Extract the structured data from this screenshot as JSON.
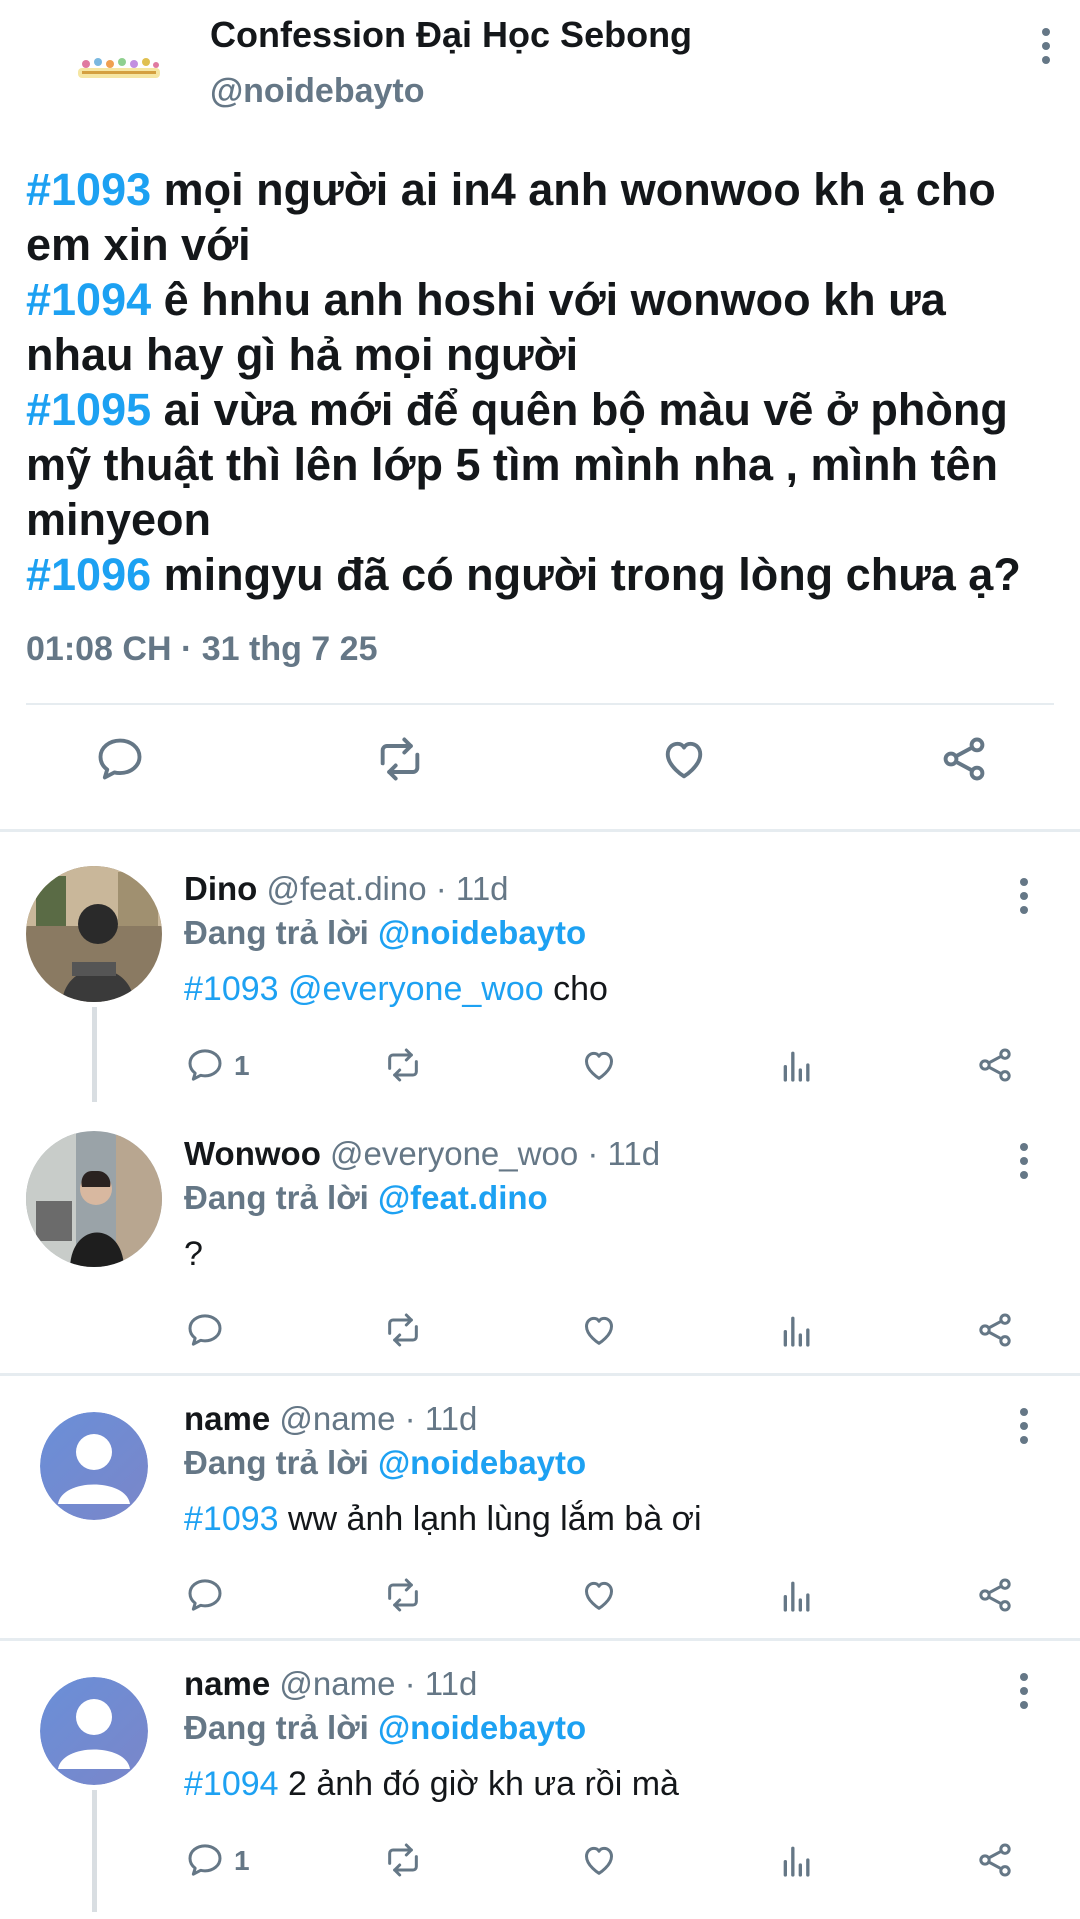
{
  "account": {
    "name": "Confession Đại Học Sebong",
    "handle": "@noidebayto"
  },
  "tweet": {
    "confessions": [
      {
        "tag": "#1093",
        "text": " mọi người ai in4 anh wonwoo kh ạ cho em xin với"
      },
      {
        "tag": "#1094",
        "text": " ê hnhu anh hoshi với wonwoo kh ưa nhau hay gì hả mọi người"
      },
      {
        "tag": "#1095",
        "text": " ai vừa mới để quên bộ màu vẽ ở phòng mỹ thuật thì lên lớp 5 tìm mình nha , mình tên minyeon"
      },
      {
        "tag": "#1096",
        "text": " mingyu đã có người trong lòng chưa ạ?"
      }
    ],
    "timestamp": "01:08 CH · 31 thg 7 25"
  },
  "replies": [
    {
      "name": "Dino",
      "meta": " @feat.dino · 11d",
      "replying_prefix": "Đang trả lời ",
      "replying_to": "@noidebayto",
      "text_highlight": "#1093 @everyone_woo",
      "text": " cho",
      "reply_count": "1"
    },
    {
      "name": "Wonwoo",
      "meta": " @everyone_woo · 11d",
      "replying_prefix": "Đang trả lời ",
      "replying_to": "@feat.dino",
      "text_highlight": "",
      "text": "?",
      "reply_count": ""
    },
    {
      "name": "name",
      "meta": " @name · 11d",
      "replying_prefix": "Đang trả lời ",
      "replying_to": "@noidebayto",
      "text_highlight": "#1093",
      "text": " ww ảnh lạnh lùng lắm bà ơi",
      "reply_count": ""
    },
    {
      "name": "name",
      "meta": " @name · 11d",
      "replying_prefix": "Đang trả lời ",
      "replying_to": "@noidebayto",
      "text_highlight": "#1094",
      "text": " 2 ảnh đó giờ kh ưa rồi mà",
      "reply_count": "1"
    }
  ],
  "icons": {
    "reply": "reply-icon",
    "retweet": "retweet-icon",
    "like": "heart-icon",
    "analytics": "analytics-icon",
    "share": "share-icon",
    "more": "more-vertical-icon"
  },
  "colors": {
    "accent": "#1da1f2",
    "secondary_text": "#657786",
    "primary_text": "#14171a",
    "divider": "#e6ecf0"
  }
}
